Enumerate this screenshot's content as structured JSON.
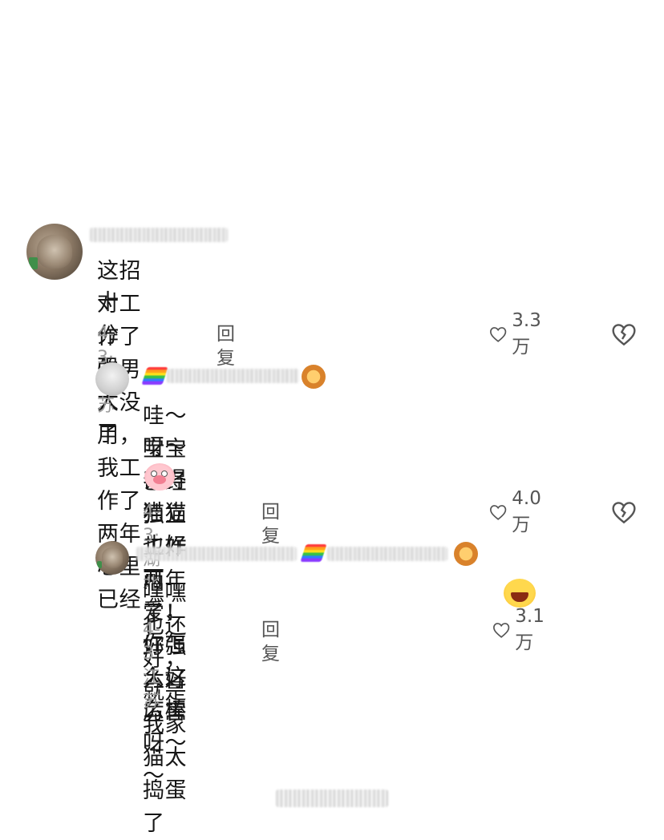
{
  "comments": [
    {
      "text_line1": "这招对工作了的男人没用，我工作了两年心里已经",
      "text_line2": "十分强大了",
      "date": "4-3· 江苏",
      "reply_label": "回复",
      "likes": "3.3万"
    },
    {
      "text_line1": "哇～宝宝已经独立工作两年了！ 好强大好厉害",
      "text_line2": "呀～养得猫猫也好可爱，你怎么这么棒呀～～",
      "emoji": "pig-face-icon",
      "date": "4-3· 湖北",
      "reply_label": "回复",
      "likes": "4.0万"
    },
    {
      "text_line1": "嘿嘿也还好，就是我家猫太捣蛋了",
      "emoji": "laughing-face-icon",
      "date": "4-3· 江苏",
      "reply_label": "回复",
      "likes": "3.1万"
    }
  ]
}
